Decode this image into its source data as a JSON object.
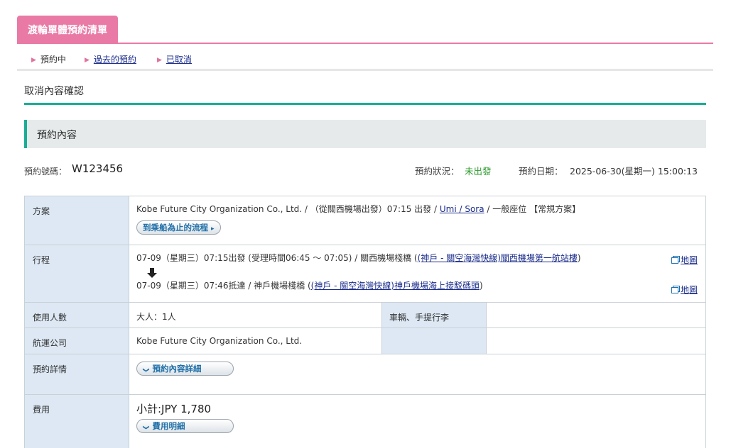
{
  "header": {
    "tab_label": "渡輪單體預約清單"
  },
  "subnav": {
    "items": [
      {
        "label": "預約中"
      },
      {
        "label": "過去的預約"
      },
      {
        "label": "已取消"
      }
    ]
  },
  "page_title": "取消內容確認",
  "section_title": "預約內容",
  "reservation": {
    "number_label": "預約號碼：",
    "number": "W123456",
    "status_label": "預約狀況：",
    "status_value": "未出發",
    "date_label": "預約日期：",
    "date_value": "2025-06-30(星期一) 15:00:13"
  },
  "table": {
    "plan": {
      "label": "方案",
      "text_a": "Kobe Future City Organization Co., Ltd. /  （從關西機場出發）07:15 出發  /",
      "ship_link": "Umi / Sora",
      "text_b": "/ 一般座位 【常規方案】",
      "flow_button": "到乘船為止的流程"
    },
    "itinerary": {
      "label": "行程",
      "dep_text": "07-09（星期三）07:15出發 (受理時間06:45 ～ 07:05) / 關西機場棧橋 (",
      "dep_link": "(神戶 - 關空海灣快線)關西機場第一航站樓",
      "dep_close": ")",
      "arr_text": "07-09（星期三）07:46抵達 / 神戶機場棧橋 (",
      "arr_link": "(神戶 - 關空海灣快線)神戶機場海上接駁碼頭",
      "arr_close": ")",
      "map_label": "地圖"
    },
    "people": {
      "label": "使用人數",
      "value": "大人：1人",
      "vehicle_label": "車輛、手提行李",
      "vehicle_value": ""
    },
    "company": {
      "label": "航運公司",
      "value": "Kobe Future City Organization Co., Ltd."
    },
    "details": {
      "label": "預約詳情",
      "button": "預約內容詳細"
    },
    "fee": {
      "label": "費用",
      "subtotal": "小計:JPY 1,780",
      "button": "費用明細"
    }
  }
}
